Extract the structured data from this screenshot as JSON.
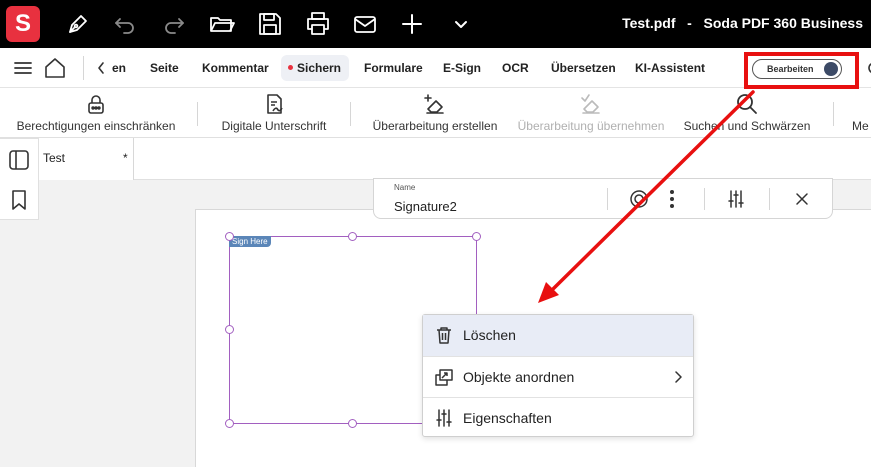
{
  "app": {
    "logo_letter": "S",
    "window_title": "Test.pdf   -   Soda PDF 360 Business"
  },
  "menubar": {
    "back_label": "en",
    "items": [
      "Seite",
      "Kommentar",
      "Sichern",
      "Formulare",
      "E-Sign",
      "OCR",
      "Übersetzen",
      "KI-Assistent"
    ],
    "active_item": "Sichern",
    "edit_toggle_label": "Bearbeiten"
  },
  "toolbar": {
    "tools": [
      {
        "label": "Berechtigungen einschränken",
        "icon": "lock-icon",
        "enabled": true
      },
      {
        "label": "Digitale Unterschrift",
        "icon": "signature-document-icon",
        "enabled": true
      },
      {
        "label": "Überarbeitung erstellen",
        "icon": "eraser-plus-icon",
        "enabled": true
      },
      {
        "label": "Überarbeitung übernehmen",
        "icon": "eraser-check-icon",
        "enabled": false
      },
      {
        "label": "Suchen und Schwärzen",
        "icon": "search-icon",
        "enabled": true
      },
      {
        "label": "Me",
        "icon": "",
        "enabled": true
      }
    ]
  },
  "tabs": [
    {
      "name": "Test",
      "modified_marker": "*"
    }
  ],
  "field_bar": {
    "name_label": "Name",
    "name_value": "Signature2"
  },
  "signature_field": {
    "tag": "Sign Here"
  },
  "context_menu": {
    "items": [
      {
        "label": "Löschen",
        "icon": "trash-icon",
        "highlighted": true,
        "submenu": false
      },
      {
        "label": "Objekte anordnen",
        "icon": "arrange-objects-icon",
        "highlighted": false,
        "submenu": true
      },
      {
        "label": "Eigenschaften",
        "icon": "sliders-icon",
        "highlighted": false,
        "submenu": false
      }
    ]
  },
  "colors": {
    "brand": "#e8313f",
    "annotation_red": "#e81010",
    "selection_purple": "#a25fc0",
    "menu_highlight": "#e8ecf6"
  }
}
